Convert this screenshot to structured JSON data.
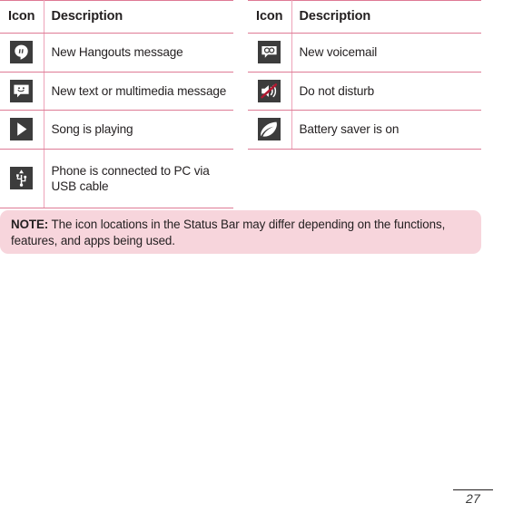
{
  "page": {
    "number": "27"
  },
  "tables": [
    {
      "id": "left",
      "headers": {
        "icon": "Icon",
        "description": "Description"
      },
      "rows": [
        {
          "icon": "hangouts-icon",
          "description": "New Hangouts message"
        },
        {
          "icon": "sms-mms-icon",
          "description": "New text or multimedia message"
        },
        {
          "icon": "play-icon",
          "description": "Song is playing"
        },
        {
          "icon": "usb-icon",
          "description": "Phone is connected to PC via USB cable"
        }
      ]
    },
    {
      "id": "right",
      "headers": {
        "icon": "Icon",
        "description": "Description"
      },
      "rows": [
        {
          "icon": "voicemail-icon",
          "description": "New voicemail"
        },
        {
          "icon": "do-not-disturb-icon",
          "description": "Do not disturb"
        },
        {
          "icon": "battery-saver-icon",
          "description": "Battery saver is on"
        }
      ]
    }
  ],
  "note": {
    "label": "NOTE:",
    "text": " The icon locations in the Status Bar may differ depending on the functions, features, and apps being used."
  },
  "colors": {
    "rule_strong": "#DE7A95",
    "rule_light": "#EDA3B8",
    "note_background": "#F7D5DC",
    "icon_background": "#3c3c3c",
    "text": "#231f20",
    "do_not_disturb_slash": "#B01830"
  }
}
